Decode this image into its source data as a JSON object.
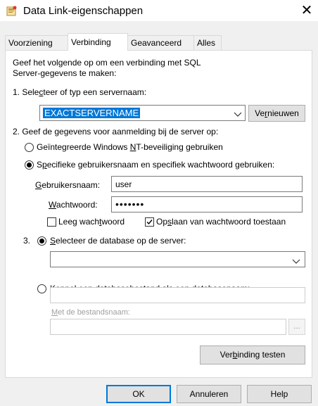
{
  "window": {
    "title": "Data Link-eigenschappen"
  },
  "tabs": [
    {
      "label": "Voorziening"
    },
    {
      "label": "Verbinding"
    },
    {
      "label": "Geavanceerd"
    },
    {
      "label": "Alles"
    }
  ],
  "instructions": {
    "line1": "Geef het volgende op om een verbinding met SQL",
    "line2": "Server-gegevens te maken:"
  },
  "step1": {
    "label_pre": "1. Sele",
    "label_u": "c",
    "label_post": "teer of typ een servernaam:",
    "server_value": "EXACTSERVERNAME",
    "refresh_pre": "Ve",
    "refresh_u": "r",
    "refresh_post": "nieuwen"
  },
  "step2": {
    "label": "2. Geef de gegevens voor aanmelding bij de server op:",
    "opt_integrated_pre": "Geïntegreerde Windows ",
    "opt_integrated_u": "N",
    "opt_integrated_post": "T-beveiliging gebruiken",
    "opt_specific_pre": "S",
    "opt_specific_u": "p",
    "opt_specific_post": "ecifieke gebruikersnaam en specifiek wachtwoord gebruiken:",
    "username_label_u": "G",
    "username_label_post": "ebruikersnaam:",
    "username_value": "user",
    "password_label_u": "W",
    "password_label_post": "achtwoord:",
    "password_value": "•••••••",
    "blank_pw_pre": "Leeg wach",
    "blank_pw_u": "t",
    "blank_pw_post": "woord",
    "save_pw_pre": "Op",
    "save_pw_u": "s",
    "save_pw_post": "laan van wachtwoord toestaan"
  },
  "step3": {
    "number": "3.",
    "opt_select_db_u": "S",
    "opt_select_db_post": "electeer de database op de server:",
    "database_value": "",
    "opt_attach_pre": "Koppel een ",
    "opt_attach_u": "d",
    "opt_attach_post": "atabasebestand als een databasenaam:",
    "filename_label_u": "M",
    "filename_label_post": "et de bestandsnaam:",
    "browse_label": "..."
  },
  "test_button": {
    "pre": "Ver",
    "u": "b",
    "post": "inding testen"
  },
  "footer": {
    "ok": "OK",
    "cancel": "Annuleren",
    "help": "Help"
  }
}
